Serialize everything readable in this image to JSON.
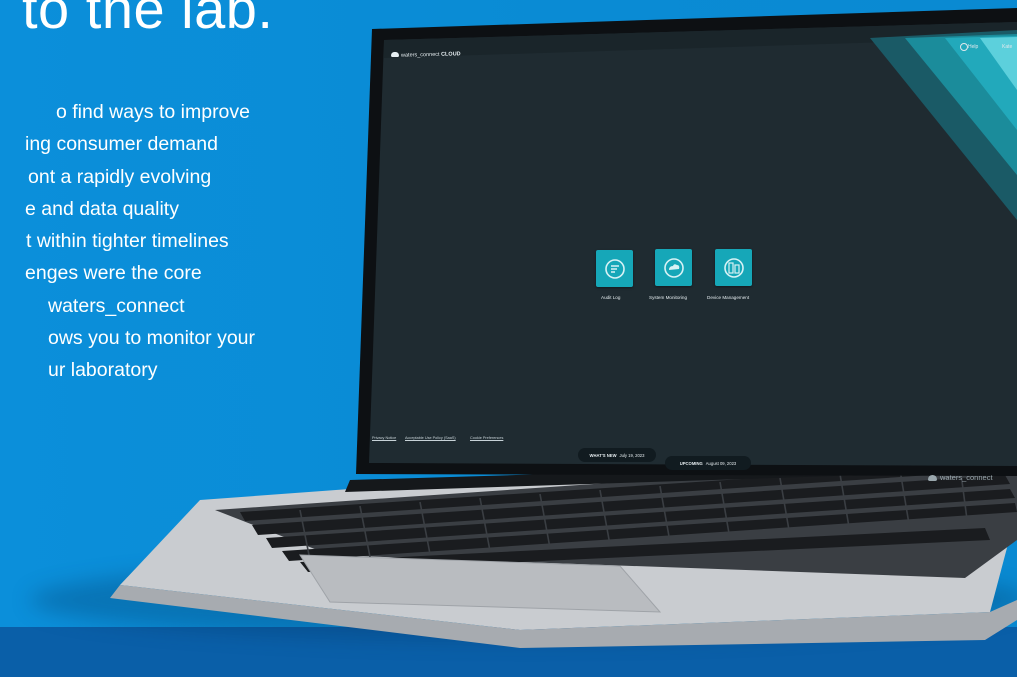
{
  "marketing": {
    "headline": "to the lab.",
    "lines": [
      "o find ways to improve",
      "ing consumer demand",
      "ont a rapidly evolving",
      "e and data quality",
      "t within tighter timelines",
      "enges were the core",
      "waters_connect",
      "ows you to monitor your",
      "ur laboratory"
    ]
  },
  "app": {
    "brand_prefix": "waters_connect",
    "brand_suffix": "CLOUD",
    "help_label": "Help",
    "user_name": "Kate",
    "tiles": [
      {
        "label": "Audit Log",
        "icon": "document-search-icon"
      },
      {
        "label": "System Monitoring",
        "icon": "cloud-monitor-icon"
      },
      {
        "label": "Device Management",
        "icon": "devices-icon"
      }
    ],
    "footer_links": [
      "Privacy Notice",
      "Acceptable Use Policy (SaaS)",
      "Cookie Preferences"
    ],
    "whats_new": {
      "label": "WHAT'S NEW",
      "date": "July 19, 2023"
    },
    "upcoming": {
      "label": "UPCOMING",
      "date": "August 09, 2023"
    },
    "watermark": "waters_connect"
  },
  "colors": {
    "background": "#0a8ed8",
    "screen": "#1f2b31",
    "tile": "#16a7b8",
    "accent_teal": "#1aa7b5"
  }
}
